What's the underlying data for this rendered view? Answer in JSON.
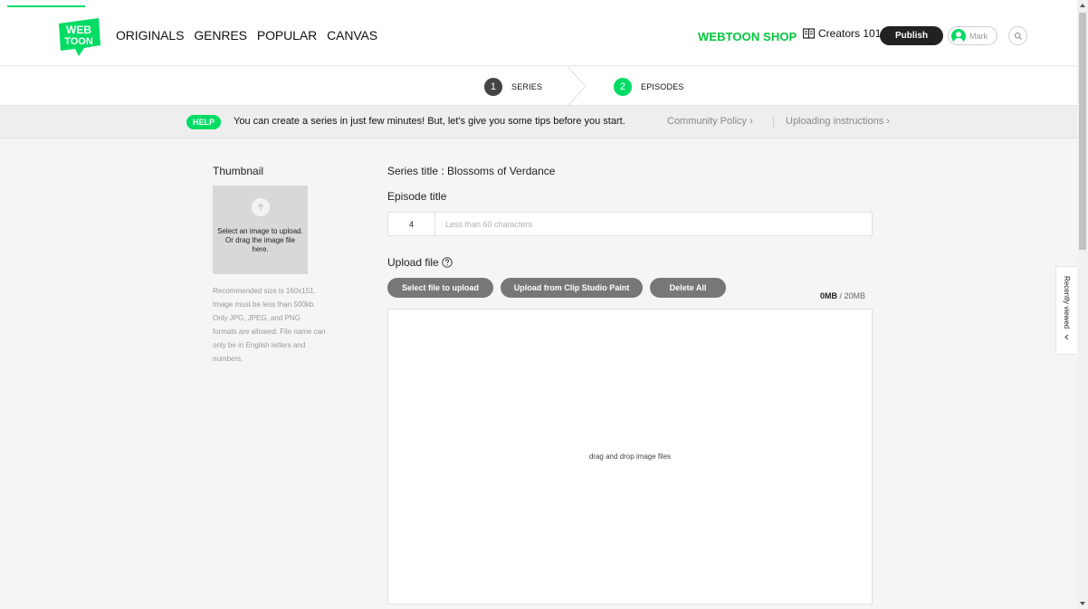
{
  "header": {
    "logo_line1": "WEB",
    "logo_line2": "TOON",
    "nav": [
      "ORIGINALS",
      "GENRES",
      "POPULAR",
      "CANVAS"
    ],
    "shop_label": "WEBTOON SHOP",
    "creators_label": "Creators 101",
    "publish_label": "Publish",
    "user_name": "Mark",
    "brand_color": "#00dc64"
  },
  "steps": [
    {
      "number": "1",
      "label": "SERIES"
    },
    {
      "number": "2",
      "label": "EPISODES"
    }
  ],
  "help": {
    "badge": "HELP",
    "text": "You can create a series in just few minutes! But, let's give you some tips before you start.",
    "link_policy": "Community Policy ›",
    "link_instructions": "Uploading instructions ›"
  },
  "thumbnail": {
    "title": "Thumbnail",
    "hint": "Select an image to upload. Or drag the image file here.",
    "note": "Recommended size is 160x151. Image must be less than 500kb. Only JPG, JPEG, and PNG formats are allowed. File name can only be in English letters and numbers."
  },
  "form": {
    "series_title": "Series title : Blossoms of Verdance",
    "episode_label": "Episode title",
    "episode_number": "4",
    "episode_placeholder": "Less than 60 characters",
    "upload_label": "Upload file",
    "buttons": {
      "select_file": "Select file to upload",
      "clip_studio": "Upload from Clip Studio Paint",
      "delete_all": "Delete All"
    },
    "size_used": "0MB",
    "size_limit": " / 20MB",
    "dropzone_text": "drag and drop image files"
  },
  "sidebar": {
    "recently_viewed": "Recently viewed"
  }
}
